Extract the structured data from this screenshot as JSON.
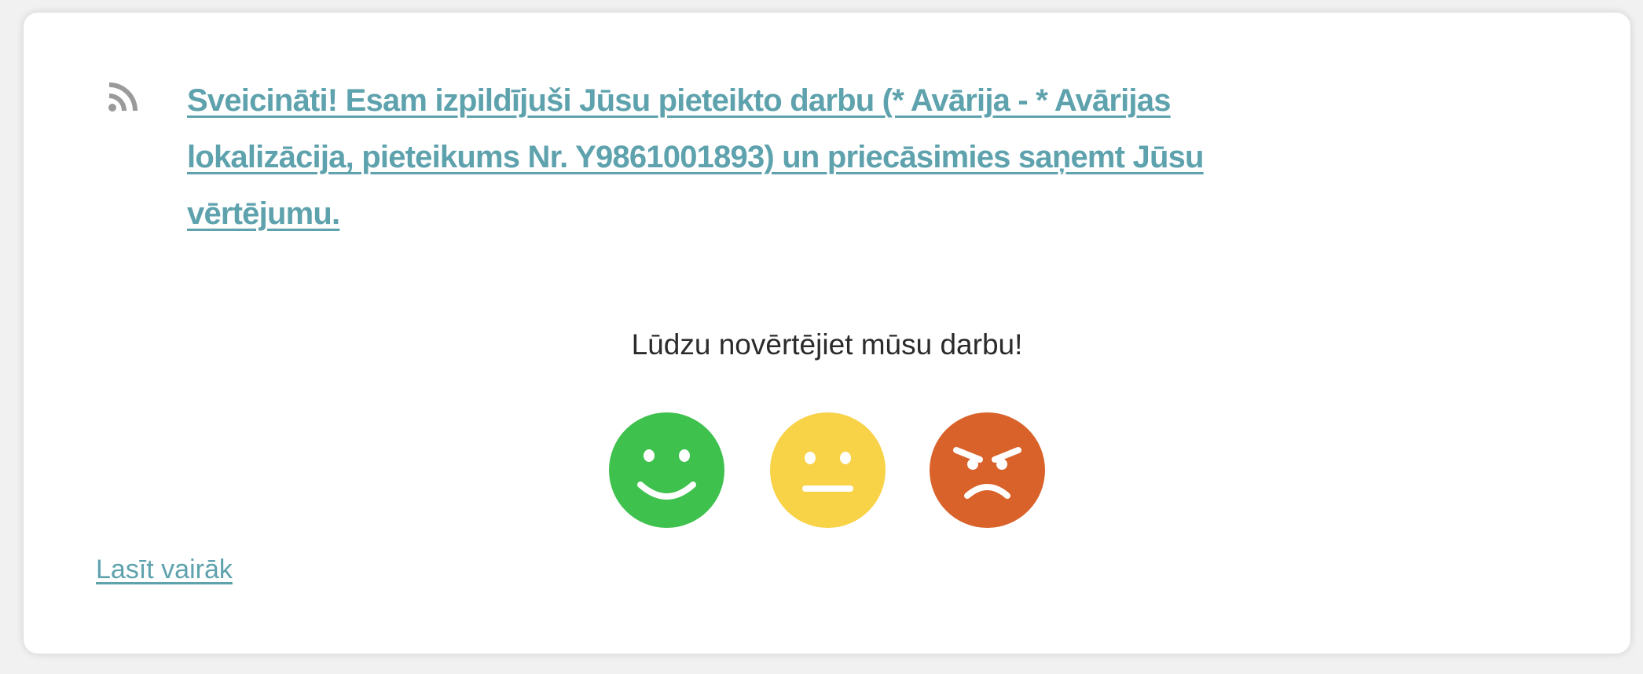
{
  "notification": {
    "icon": "rss-icon",
    "message": "Sveicināti! Esam izpildījuši Jūsu pieteikto darbu (* Avārija - * Avārijas lokalizācija, pieteikums Nr. Y9861001893) un priecāsimies saņemt Jūsu vērtējumu.",
    "link_color": "#5ea2ad"
  },
  "rating": {
    "prompt": "Lūdzu novērtējiet mūsu darbu!",
    "options": [
      {
        "icon": "happy-face-icon",
        "color": "#3fc14e"
      },
      {
        "icon": "neutral-face-icon",
        "color": "#f8d247"
      },
      {
        "icon": "angry-face-icon",
        "color": "#d9622a"
      }
    ]
  },
  "footer": {
    "read_more": "Lasīt vairāk"
  }
}
